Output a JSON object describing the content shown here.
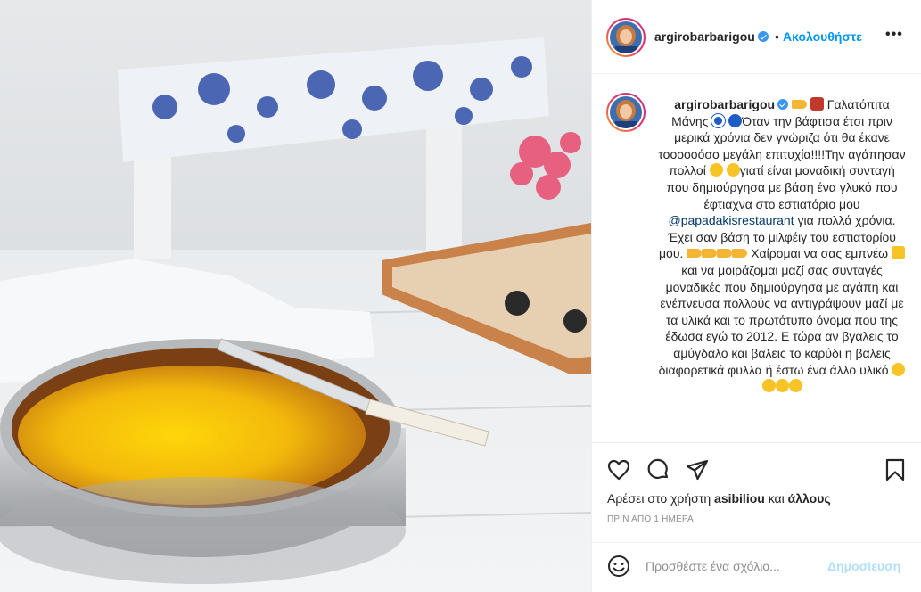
{
  "post": {
    "username": "argirobarbarigou",
    "dot": "•",
    "follow_label": "Ακολουθήστε",
    "more_label": "•••"
  },
  "caption": {
    "author": "argirobarbarigou",
    "seg1": " Γαλατόπιτα Μάνης",
    "seg2": "Όταν την βάφτισα έτσι πριν μερικά χρόνια δεν γνώριζα ότι θα έκανε τοοοοοόσο μεγάλη επιτυχία!!!!Την αγάπησαν πολλοί ",
    "seg3": "γιατί είναι μοναδική συνταγή που δημιούργησα με βάση ένα γλυκό που έφτιαχνα στο εστιατόριο μου ",
    "mention": "@papadakisrestaurant",
    "seg4": " για πολλά χρόνια. Έχει σαν βάση το μιλφέιγ του εστιατορίου μου. ",
    "seg5": " Χαίρομαι να σας εμπνέω ",
    "seg6": " και να μοιράζομαι μαζί σας συνταγές μοναδικές που δημιούργησα με αγάπη και ενέπνευσα πολλούς να αντιγράψουν μαζί με τα υλικά και το πρωτότυπο όνομα που της έδωσα εγώ το 2012. Ε τώρα αν βγαλεις το αμύγδαλο και βαλεις το καρύδι η βαλεις διαφορετικά φυλλα ή έστω ένα άλλο υλικό "
  },
  "likes": {
    "prefix": "Αρέσει στο χρήστη ",
    "user": "asibiliou",
    "mid": " και ",
    "others": "άλλους"
  },
  "timestamp": "ΠΡΙΝ ΑΠΟ 1 ΗΜΕΡΑ",
  "comment_box": {
    "placeholder": "Προσθέστε ένα σχόλιο...",
    "post_label": "Δημοσίευση"
  },
  "colors": {
    "link_blue": "#0095f6",
    "mention": "#00376b",
    "muted": "#8e8e8e",
    "post_disabled": "#b2dffc"
  },
  "icons": [
    "heart-icon",
    "comment-icon",
    "share-icon",
    "bookmark-icon",
    "smiley-icon",
    "verified-badge-icon",
    "more-icon"
  ]
}
